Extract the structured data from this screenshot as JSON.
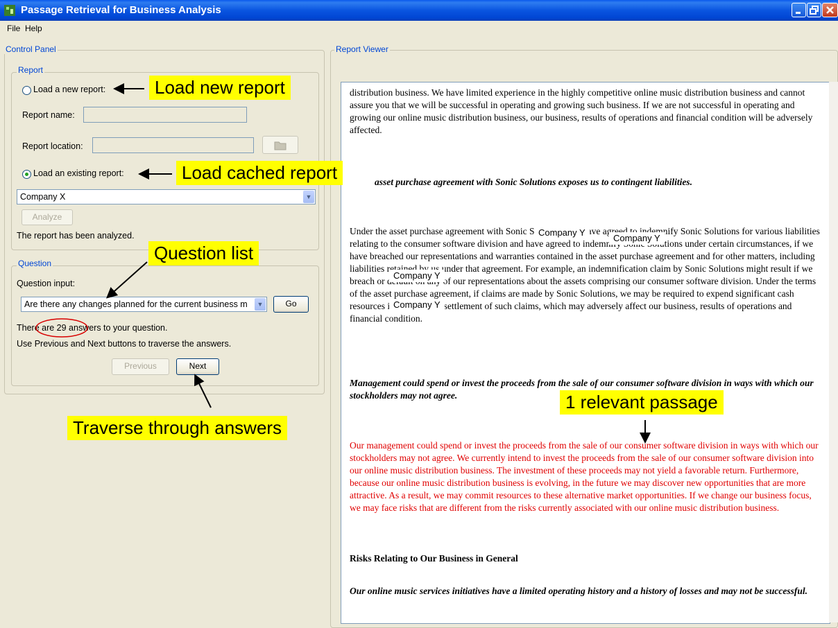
{
  "window": {
    "title": "Passage Retrieval for Business Analysis"
  },
  "menu": [
    "File",
    "Help"
  ],
  "control_panel": {
    "legend": "Control Panel",
    "report": {
      "legend": "Report",
      "load_new_label": "Load a new report:",
      "report_name_label": "Report name:",
      "report_location_label": "Report location:",
      "load_existing_label": "Load an existing report:",
      "selected_report": "Company X",
      "analyze_label": "Analyze",
      "status": "The report has been analyzed."
    },
    "question": {
      "legend": "Question",
      "input_label": "Question input:",
      "selected_question": "Are there any changes planned for the current business m",
      "go_label": "Go",
      "answers_text": "There are 29 answers to your question.",
      "instructions": "Use Previous and Next buttons to traverse the answers.",
      "previous_label": "Previous",
      "next_label": "Next"
    }
  },
  "report_viewer": {
    "legend": "Report Viewer",
    "para1": "distribution business. We have limited experience in the highly competitive online music distribution business and cannot assure you that we will be successful in operating and growing such business. If we are not successful in operating and growing our online music distribution business, our business, results of operations and financial condition will be adversely affected.",
    "heading1": "asset purchase agreement with Sonic Solutions exposes us to contingent liabilities.",
    "para2": "Under the asset purchase agreement with Sonic Solutions, we have agreed to indemnify Sonic Solutions for various liabilities relating to the consumer software division and have agreed to indemnify Sonic Solutions under certain circumstances, if we have breached our representations and warranties contained in the asset purchase agreement and for other matters, including liabilities retained by us under that agreement. For example, an indemnification claim by Sonic Solutions might result if we breach or default on any of our representations about the assets comprising our consumer software division. Under the terms of the asset purchase agreement, if claims are made by Sonic Solutions, we may be required to expend significant cash resources in defense and settlement of such claims, which may adversely affect our business, results of operations and financial condition.",
    "company_masks": [
      "Company Y",
      "Company Y",
      "Company Y",
      "Company Y"
    ],
    "heading2": "Management could spend or invest the proceeds from the sale of our consumer software division in ways with which our stockholders may not agree.",
    "para3_relevant": "Our management could spend or invest the proceeds from the sale of our consumer software division in ways with which our stockholders may not agree. We currently intend to invest the proceeds from the sale of our consumer software division into our online music distribution business. The investment of these proceeds may not yield a favorable return. Furthermore, because our online music distribution business is evolving, in the future we may discover new opportunities that are more attractive. As a result, we may commit resources to these alternative market opportunities. If we change our business focus, we may face risks that are different from the risks currently associated with our online music distribution business.",
    "heading3": "Risks Relating to Our Business in General",
    "heading4": "Our online music services initiatives have a limited operating history and a history of losses and may not be successful."
  },
  "callouts": {
    "load_new": "Load new report",
    "load_cached": "Load cached report",
    "question_list": "Question list",
    "traverse": "Traverse through answers",
    "relevant": "1 relevant passage"
  },
  "colors": {
    "callout": "#ffff00",
    "relevant_text": "#e00000",
    "titlebar": "#0a55e0"
  }
}
